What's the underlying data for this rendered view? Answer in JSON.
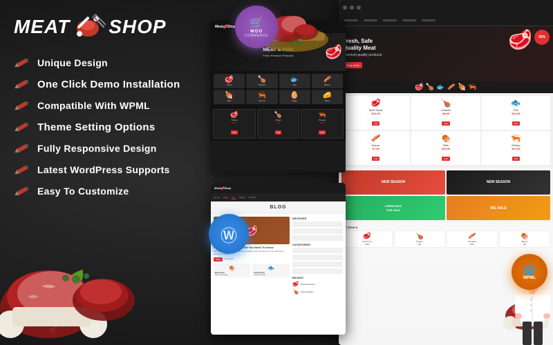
{
  "theme": {
    "name": "MeatShop",
    "logo": {
      "text_left": "Meat",
      "text_right": "Shop",
      "icon": "🥩"
    },
    "background_color": "#1c1c1c",
    "accent_color": "#e03030"
  },
  "features": [
    {
      "id": "unique-design",
      "label": "Unique Design"
    },
    {
      "id": "one-click-demo",
      "label": "One Click Demo Installation"
    },
    {
      "id": "wpml-compat",
      "label": "Compatible With WPML"
    },
    {
      "id": "theme-settings",
      "label": "Theme Setting Options"
    },
    {
      "id": "responsive",
      "label": "Fully Responsive Design"
    },
    {
      "id": "wp-supports",
      "label": "Latest WordPress Supports"
    },
    {
      "id": "customizable",
      "label": "Easy To Customize"
    }
  ],
  "badges": {
    "woocommerce": {
      "icon": "🛒",
      "label": "WOO",
      "sublabel": "COMMERCE"
    },
    "wordpress": {
      "icon": "⓵"
    },
    "wpml": {
      "icon": "🌐",
      "label": "WPML"
    }
  },
  "mockup": {
    "hero": {
      "title": "Fresh, Safe\nQuality Meat",
      "badge": "30%",
      "button": "Shop Now"
    },
    "blog": {
      "section_title": "BLOG",
      "nav_items": [
        "Home",
        "Shop",
        "Blog",
        "Pages",
        "Contact"
      ]
    },
    "categories": {
      "title": "MEAT & FISH",
      "items": [
        "🥩",
        "🍗",
        "🐟",
        "🥓",
        "🍖",
        "🦐"
      ]
    }
  },
  "decorations": {
    "herb_emoji": "🌿",
    "meat_emojis": [
      "🥩",
      "🍖",
      "🥓",
      "🍗"
    ],
    "chef_label": "Chef"
  },
  "seasonal_banners": [
    {
      "label": "NEW SEASON",
      "color": "red"
    },
    {
      "label": "NEW SEASON",
      "color": "dark"
    },
    {
      "label": "CHRISTMAS\nFOR SALE",
      "color": "green"
    },
    {
      "label": "BIG SALE",
      "color": "orange"
    }
  ]
}
